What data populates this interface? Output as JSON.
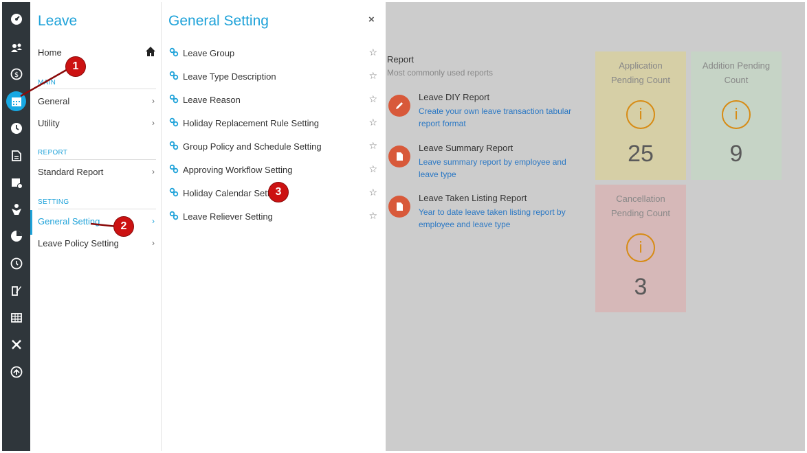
{
  "module": {
    "title": "Leave",
    "home": "Home",
    "sections": [
      {
        "header": "MAIN",
        "items": [
          "General",
          "Utility"
        ]
      },
      {
        "header": "REPORT",
        "items": [
          "Standard Report"
        ]
      },
      {
        "header": "SETTING",
        "items": [
          "General Setting",
          "Leave Policy Setting"
        ]
      }
    ]
  },
  "panel": {
    "title": "General Setting",
    "close": "×",
    "items": [
      "Leave Group",
      "Leave Type Description",
      "Leave Reason",
      "Holiday Replacement Rule Setting",
      "Group Policy and Schedule Setting",
      "Approving Workflow Setting",
      "Holiday Calendar Setting",
      "Leave Reliever Setting"
    ]
  },
  "reports": {
    "title": "Report",
    "subtitle": "Most commonly used reports",
    "items": [
      {
        "name": "Leave DIY Report",
        "desc": "Create your own leave transaction tabular report format",
        "icon": "pencil-icon"
      },
      {
        "name": "Leave Summary Report",
        "desc": "Leave summary report by employee and leave type",
        "icon": "document-icon"
      },
      {
        "name": "Leave Taken Listing Report",
        "desc": "Year to date leave taken listing report by employee and leave type",
        "icon": "document-icon"
      }
    ]
  },
  "cards": [
    {
      "title_line1": "Application",
      "title_line2": "Pending Count",
      "icon": "i",
      "count": "25",
      "bg": "#d6cfa6"
    },
    {
      "title_line1": "Addition Pending",
      "title_line2": "Count",
      "icon": "i",
      "count": "9",
      "bg": "#c6d4c6"
    },
    {
      "title_line1": "Cancellation",
      "title_line2": "Pending Count",
      "icon": "i",
      "count": "3",
      "bg": "#d6b8b8"
    }
  ],
  "markers": [
    "1",
    "2",
    "3"
  ],
  "colors": {
    "accent": "#1ea2d9",
    "rail": "#2f363b",
    "report_badge": "#d8593a",
    "card_icon": "#d78b14",
    "marker": "#cc1212"
  }
}
